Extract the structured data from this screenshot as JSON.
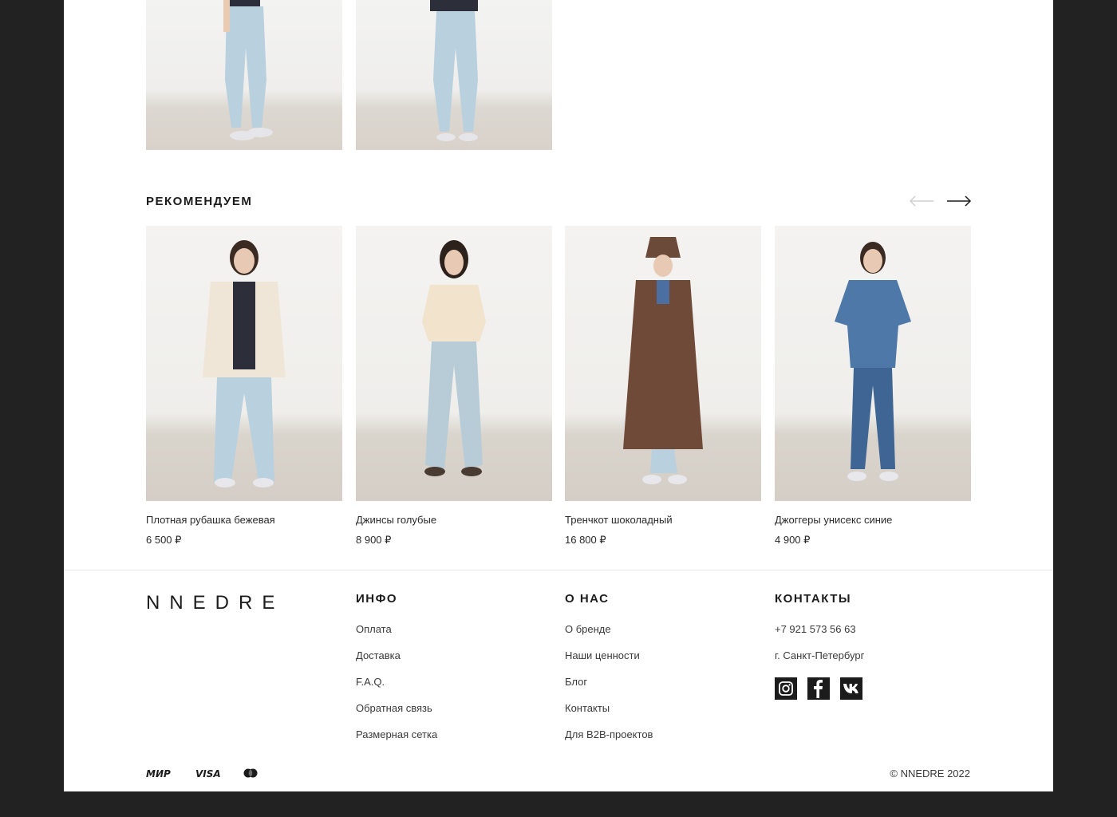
{
  "recommend": {
    "title": "РЕКОМЕНДУЕМ",
    "products": [
      {
        "name": "Плотная рубашка бежевая",
        "price": "6 500 ₽"
      },
      {
        "name": "Джинсы голубые",
        "price": "8 900 ₽"
      },
      {
        "name": "Тренчкот шоколадный",
        "price": "16 800 ₽"
      },
      {
        "name": "Джоггеры унисекс синие",
        "price": "4 900 ₽"
      }
    ]
  },
  "footer": {
    "logo": "NNEDRE",
    "info": {
      "title": "ИНФО",
      "links": [
        "Оплата",
        "Доставка",
        "F.A.Q.",
        "Обратная связь",
        "Размерная сетка"
      ]
    },
    "about": {
      "title": "О НАС",
      "links": [
        "О бренде",
        "Наши ценности",
        "Блог",
        "Контакты",
        "Для B2B-проектов"
      ]
    },
    "contacts": {
      "title": "КОНТАКТЫ",
      "phone": "+7 921 573 56 63",
      "city": "г. Санкт-Петербург",
      "socials": [
        "instagram-icon",
        "facebook-icon",
        "vk-icon"
      ]
    },
    "payments": [
      "МИР",
      "VISA",
      "mastercard-icon"
    ],
    "copyright": "© NNEDRE 2022"
  },
  "colors": {
    "background": "#222222",
    "page": "#ffffff",
    "text": "#1c1c1c"
  }
}
